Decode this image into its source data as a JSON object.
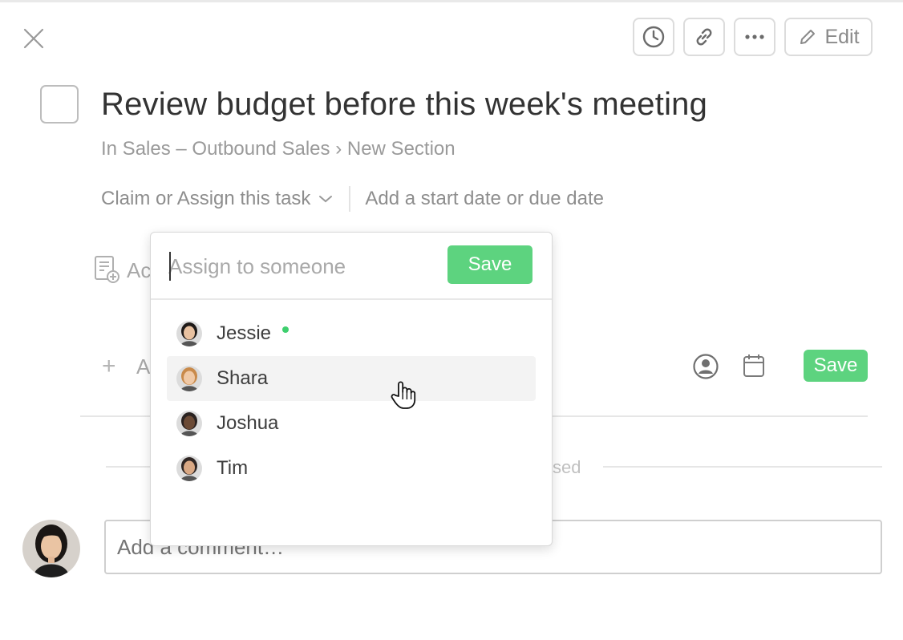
{
  "header": {
    "close_icon": "close-icon",
    "toolbar": [
      {
        "name": "history-button",
        "icon": "clock-icon"
      },
      {
        "name": "link-button",
        "icon": "link-icon"
      },
      {
        "name": "more-button",
        "icon": "ellipsis-icon"
      }
    ],
    "edit_label": "Edit"
  },
  "task": {
    "title": "Review budget before this week's meeting",
    "breadcrumb_prefix": "In Sales – Outbound Sales",
    "breadcrumb_separator": "›",
    "breadcrumb_section": "New Section",
    "assign_label": "Claim or Assign this task",
    "date_label": "Add a start date or due date"
  },
  "background": {
    "description_partial": "Ac",
    "subtask_partial": "A",
    "collapsed_partial": "sed",
    "subtask_save_label": "Save"
  },
  "assign_dropdown": {
    "placeholder": "Assign to someone",
    "save_label": "Save",
    "people": [
      {
        "name": "Jessie",
        "online": true,
        "hovered": false,
        "skin": "#e8c1a0",
        "hair": "#1e1a18"
      },
      {
        "name": "Shara",
        "online": false,
        "hovered": true,
        "skin": "#f0c9a6",
        "hair": "#c98a4a"
      },
      {
        "name": "Joshua",
        "online": false,
        "hovered": false,
        "skin": "#6b4a35",
        "hair": "#2a2220"
      },
      {
        "name": "Tim",
        "online": false,
        "hovered": false,
        "skin": "#d9a884",
        "hair": "#2f2624"
      }
    ]
  },
  "comment": {
    "placeholder": "Add a comment…"
  },
  "colors": {
    "accent_green": "#5dd37f",
    "online_dot": "#3ecf6e"
  }
}
